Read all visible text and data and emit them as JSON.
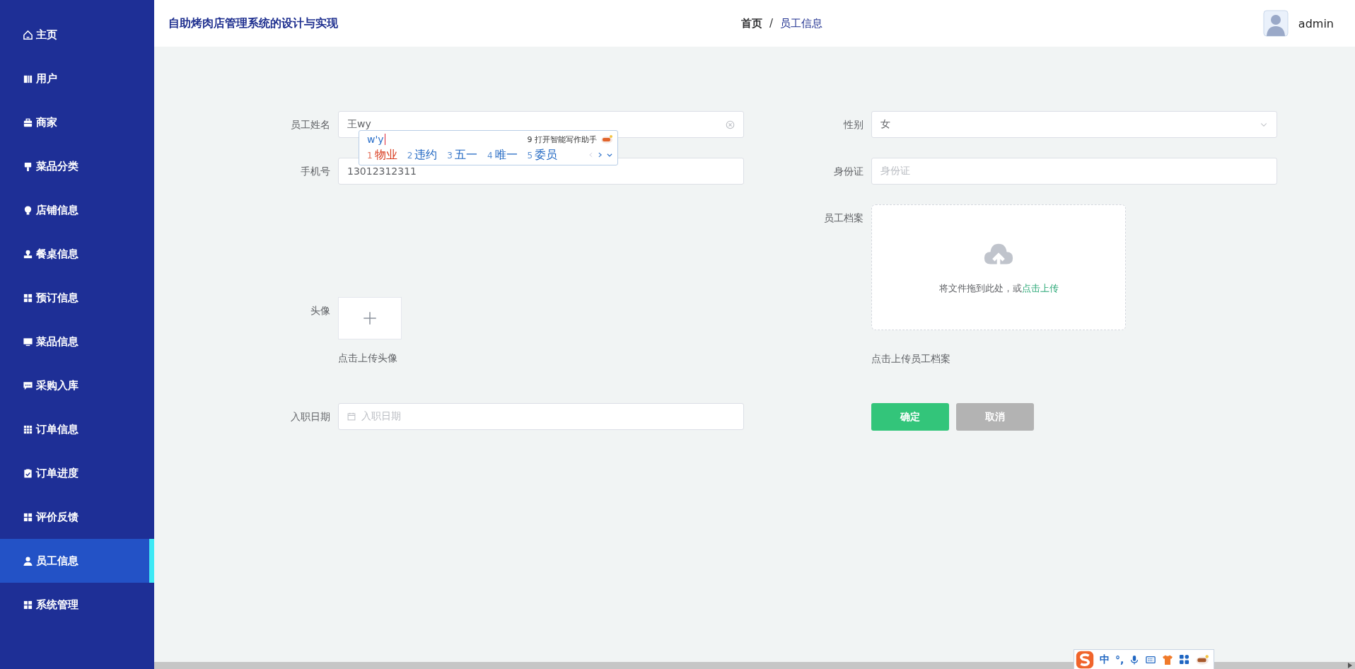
{
  "sidebar": {
    "items": [
      {
        "label": "主页",
        "selected": false
      },
      {
        "label": "用户",
        "selected": false
      },
      {
        "label": "商家",
        "selected": false
      },
      {
        "label": "菜品分类",
        "selected": false
      },
      {
        "label": "店铺信息",
        "selected": false
      },
      {
        "label": "餐桌信息",
        "selected": false
      },
      {
        "label": "预订信息",
        "selected": false
      },
      {
        "label": "菜品信息",
        "selected": false
      },
      {
        "label": "采购入库",
        "selected": false
      },
      {
        "label": "订单信息",
        "selected": false
      },
      {
        "label": "订单进度",
        "selected": false
      },
      {
        "label": "评价反馈",
        "selected": false
      },
      {
        "label": "员工信息",
        "selected": true
      },
      {
        "label": "系统管理",
        "selected": false
      }
    ]
  },
  "header": {
    "title": "自助烤肉店管理系统的设计与实现",
    "breadcrumb": [
      {
        "label": "首页",
        "current": false
      },
      {
        "label": "员工信息",
        "current": true
      }
    ],
    "separator": "/",
    "user": "admin"
  },
  "form": {
    "rows": [
      {
        "left": {
          "kind": "text",
          "label": "员工姓名",
          "value": "王wy",
          "clearable": true
        },
        "right": {
          "kind": "select",
          "label": "性别",
          "value": "女"
        }
      },
      {
        "left": {
          "kind": "text",
          "label": "手机号",
          "value": "13012312311"
        },
        "right": {
          "kind": "text",
          "label": "身份证",
          "placeholder": "身份证"
        }
      },
      {
        "left": {
          "kind": "image-upload",
          "label": "头像",
          "hint": "点击上传头像"
        },
        "right": {
          "kind": "file-upload",
          "label": "员工档案",
          "prompt": "将文件拖到此处，或",
          "link": "点击上传",
          "hint": "点击上传员工档案"
        }
      },
      {
        "left": {
          "kind": "date",
          "label": "入职日期",
          "placeholder": "入职日期"
        },
        "right": {
          "kind": "buttons",
          "buttons": [
            {
              "label": "确定",
              "kind": "primary"
            },
            {
              "label": "取消",
              "kind": "secondary"
            }
          ]
        }
      }
    ]
  },
  "ime_popup": {
    "composition": "w'y",
    "assistant": "9 打开智能写作助手",
    "candidates": [
      {
        "number": "1",
        "text": "物业",
        "selected": true
      },
      {
        "number": "2",
        "text": "违约",
        "selected": false
      },
      {
        "number": "3",
        "text": "五一",
        "selected": false
      },
      {
        "number": "4",
        "text": "唯一",
        "selected": false
      },
      {
        "number": "5",
        "text": "委员",
        "selected": false
      }
    ]
  },
  "ime_toolbar": {
    "mode": "中",
    "punctuation": "°,"
  }
}
